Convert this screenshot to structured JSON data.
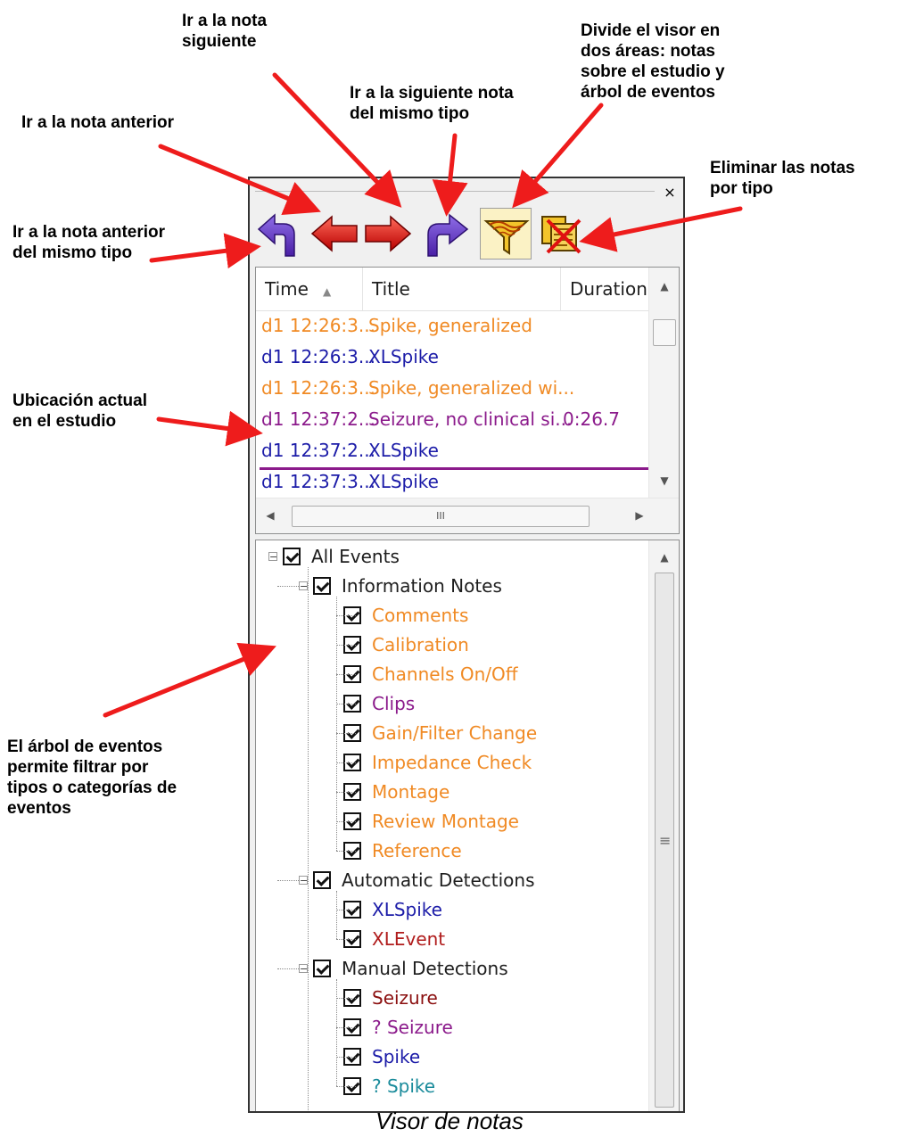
{
  "callouts": {
    "siguiente_nota": "Ir a la nota\nsiguiente",
    "divide_visor": "Divide el visor en\ndos áreas: notas\nsobre el estudio y\nárbol de eventos",
    "siguiente_mismo_tipo": "Ir a la siguiente nota\ndel mismo tipo",
    "nota_anterior": "Ir a la nota anterior",
    "eliminar_por_tipo": "Eliminar las notas\npor tipo",
    "anterior_mismo_tipo": "Ir a la nota anterior\ndel mismo tipo",
    "ubicacion_actual": "Ubicación actual\nen el estudio",
    "arbol_eventos": "El árbol de eventos\npermite filtrar por\ntipos o categorías de\neventos"
  },
  "caption": "Visor de notas",
  "panel": {
    "close_glyph": "×",
    "toolbar": [
      {
        "name": "prev-same-type-button",
        "icon": "curved-arrow-left-icon",
        "color": "#6b3fc4"
      },
      {
        "name": "prev-note-button",
        "icon": "arrow-left-icon",
        "color": "#d40000"
      },
      {
        "name": "next-note-button",
        "icon": "arrow-right-icon",
        "color": "#d40000"
      },
      {
        "name": "next-same-type-button",
        "icon": "curved-arrow-right-icon",
        "color": "#6b3fc4"
      },
      {
        "name": "split-view-button",
        "icon": "filter-funnel-icon",
        "pressed": true
      },
      {
        "name": "delete-by-type-button",
        "icon": "delete-notes-icon"
      }
    ],
    "grid": {
      "headers": {
        "time": "Time",
        "title": "Title",
        "duration": "Duration"
      },
      "sort_glyph": "▲",
      "rows": [
        {
          "time": "d1 12:26:3...",
          "title": "Spike, generalized",
          "duration": "",
          "color": "#f08a24"
        },
        {
          "time": "d1 12:26:3...",
          "title": "XLSpike",
          "duration": "",
          "color": "#1c1ca8"
        },
        {
          "time": "d1 12:26:3...",
          "title": "Spike, generalized wi...",
          "duration": "",
          "color": "#f08a24"
        },
        {
          "time": "d1 12:37:2...",
          "title": "Seizure, no clinical si...",
          "duration": "0:26.7",
          "color": "#8b1a8b"
        },
        {
          "time": "d1 12:37:2...",
          "title": "XLSpike",
          "duration": "",
          "color": "#1c1ca8"
        },
        {
          "time": "d1 12:37:3...",
          "title": "XLSpike",
          "duration": "",
          "color": "#1c1ca8"
        }
      ],
      "hscroll_grip": "III"
    },
    "tree": {
      "scroll_grip": "≡",
      "root": "All Events",
      "groups": [
        {
          "label": "Information Notes",
          "items": [
            {
              "label": "Comments",
              "color": "#f08a24"
            },
            {
              "label": "Calibration",
              "color": "#f08a24"
            },
            {
              "label": "Channels On/Off",
              "color": "#f08a24"
            },
            {
              "label": "Clips",
              "color": "#8b1a8b"
            },
            {
              "label": "Gain/Filter Change",
              "color": "#f08a24"
            },
            {
              "label": "Impedance Check",
              "color": "#f08a24"
            },
            {
              "label": "Montage",
              "color": "#f08a24"
            },
            {
              "label": "Review Montage",
              "color": "#f08a24"
            },
            {
              "label": "Reference",
              "color": "#f08a24"
            }
          ]
        },
        {
          "label": "Automatic Detections",
          "items": [
            {
              "label": "XLSpike",
              "color": "#1c1ca8"
            },
            {
              "label": "XLEvent",
              "color": "#b01c1c"
            }
          ]
        },
        {
          "label": "Manual Detections",
          "items": [
            {
              "label": "Seizure",
              "color": "#8b1010"
            },
            {
              "label": "? Seizure",
              "color": "#8b1a8b"
            },
            {
              "label": "Spike",
              "color": "#1c1ca8"
            },
            {
              "label": "? Spike",
              "color": "#1a8b9b"
            }
          ]
        }
      ]
    }
  },
  "colors": {
    "arrow": "#ee1c1c",
    "current_marker": "#8b1a8b"
  }
}
